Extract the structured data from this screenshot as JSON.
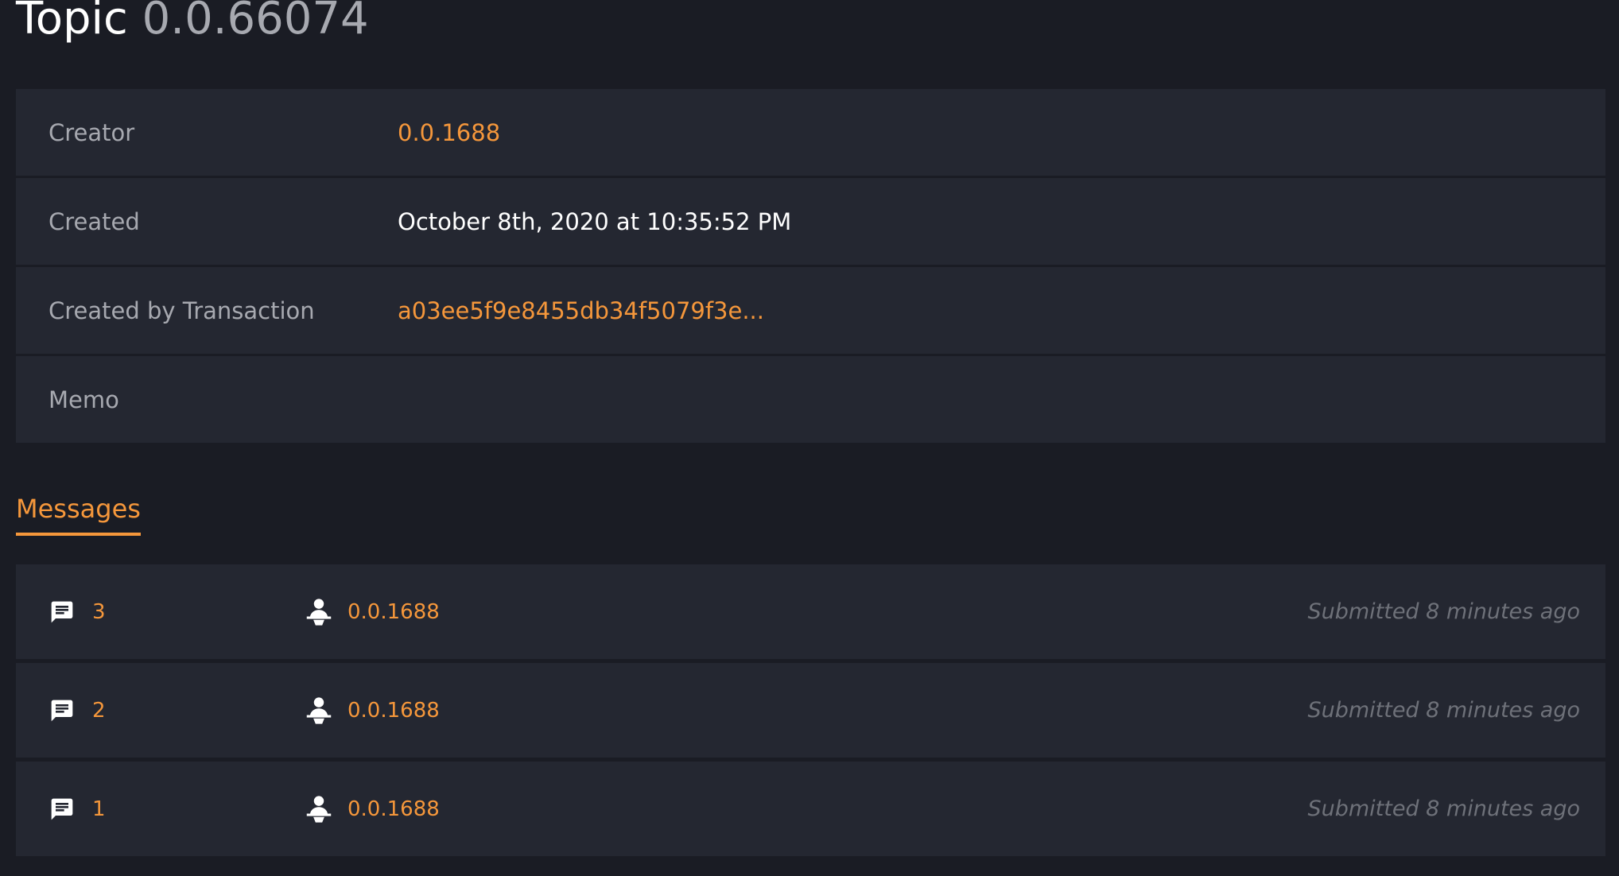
{
  "header": {
    "title_prefix": "Topic",
    "topic_id": "0.0.66074"
  },
  "details": {
    "rows": [
      {
        "label": "Creator",
        "value": "0.0.1688"
      },
      {
        "label": "Created",
        "value": "October 8th, 2020 at 10:35:52 PM"
      },
      {
        "label": "Created by Transaction",
        "value": "a03ee5f9e8455db34f5079f3e..."
      },
      {
        "label": "Memo",
        "value": ""
      }
    ]
  },
  "tabs": {
    "messages_label": "Messages"
  },
  "messages": [
    {
      "sequence": "3",
      "account": "0.0.1688",
      "time": "Submitted 8 minutes ago"
    },
    {
      "sequence": "2",
      "account": "0.0.1688",
      "time": "Submitted 8 minutes ago"
    },
    {
      "sequence": "1",
      "account": "0.0.1688",
      "time": "Submitted 8 minutes ago"
    }
  ],
  "icons": {
    "message": "message-icon",
    "payer": "payer-icon"
  },
  "colors": {
    "background": "#1a1c24",
    "card": "#242731",
    "accent": "#f5973b",
    "muted": "#a7a9b0",
    "timestamp": "#6e7179"
  }
}
